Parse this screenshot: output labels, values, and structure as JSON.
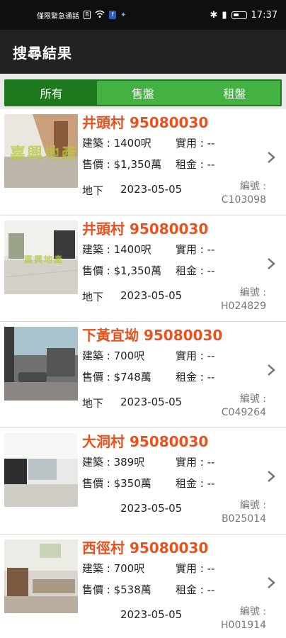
{
  "status_bar": {
    "carrier": "僅限緊急通話",
    "time": "17:37"
  },
  "header": {
    "title": "搜尋結果"
  },
  "tabs": [
    {
      "label": "所有",
      "active": true
    },
    {
      "label": "售盤",
      "active": false
    },
    {
      "label": "租盤",
      "active": false
    }
  ],
  "labels": {
    "building": "建築 : ",
    "usable": "實用 : ",
    "price": "售價 : ",
    "rent": "租金 : ",
    "code": "編號 :"
  },
  "listings": [
    {
      "title": "井頭村 95080030",
      "building": "1400呎",
      "usable": "--",
      "price": "$1,350萬",
      "rent": "--",
      "floor": "地下",
      "date": "2023-05-05",
      "code": "C103098",
      "watermark": "嘉興地產"
    },
    {
      "title": "井頭村 95080030",
      "building": "1400呎",
      "usable": "--",
      "price": "$1,350萬",
      "rent": "--",
      "floor": "地下",
      "date": "2023-05-05",
      "code": "H024829",
      "watermark": "嘉興地產"
    },
    {
      "title": "下黃宜坳 95080030",
      "building": "700呎",
      "usable": "--",
      "price": "$748萬",
      "rent": "--",
      "floor": "地下",
      "date": "2023-05-05",
      "code": "C049264",
      "watermark": ""
    },
    {
      "title": "大洞村 95080030",
      "building": "389呎",
      "usable": "--",
      "price": "$350萬",
      "rent": "--",
      "floor": "",
      "date": "2023-05-05",
      "code": "B025014",
      "watermark": ""
    },
    {
      "title": "西徑村 95080030",
      "building": "700呎",
      "usable": "--",
      "price": "$538萬",
      "rent": "--",
      "floor": "",
      "date": "2023-05-05",
      "code": "H001914",
      "watermark": ""
    }
  ],
  "colors": {
    "accent": "#e8521e",
    "tab_active": "#1f7a1f",
    "tab_inactive": "#43b243"
  }
}
